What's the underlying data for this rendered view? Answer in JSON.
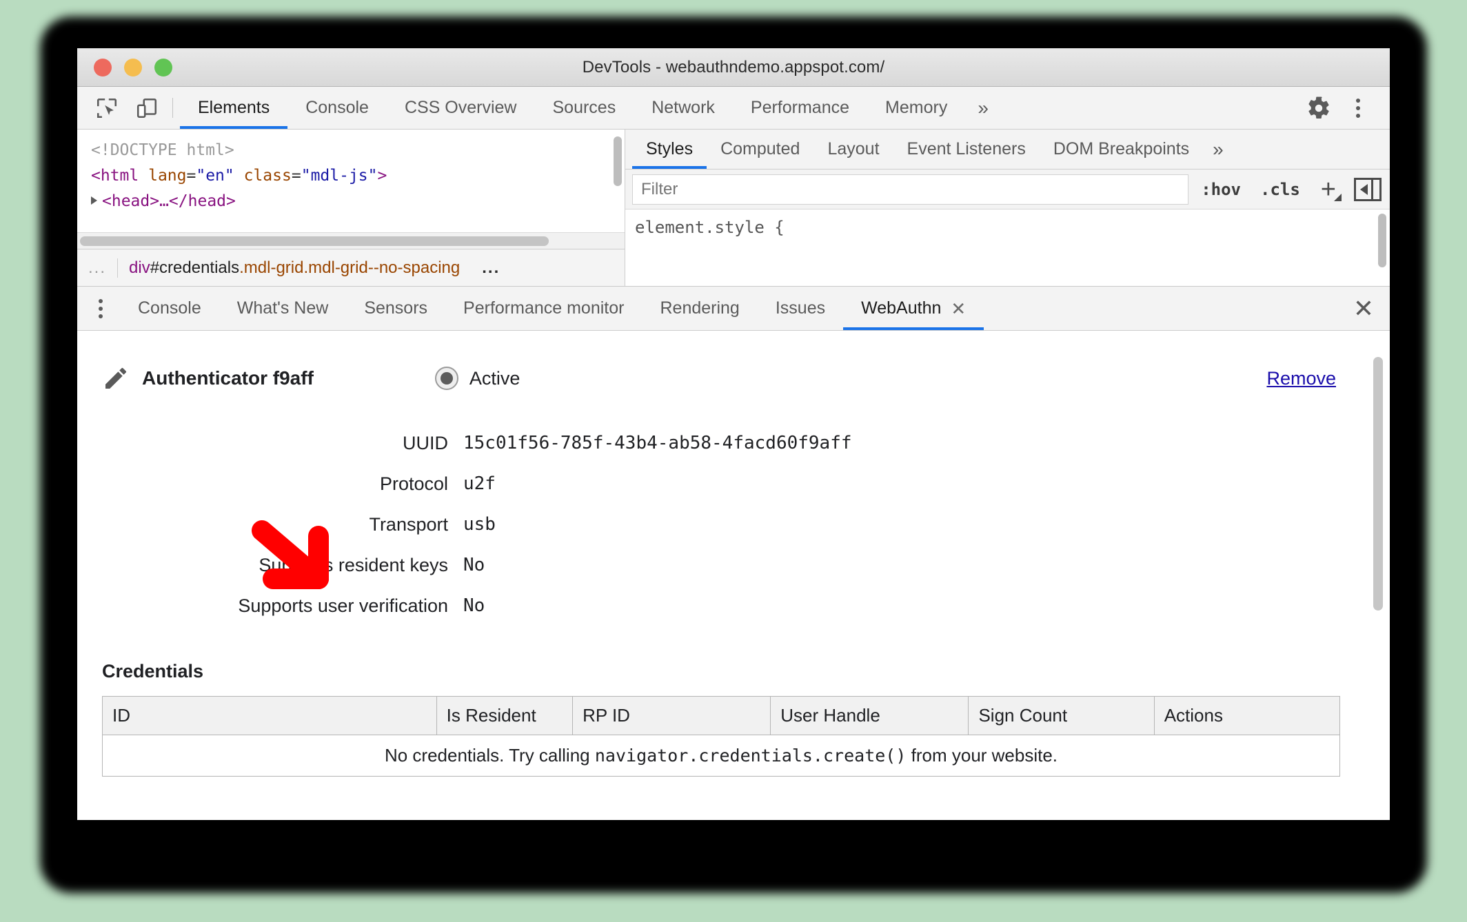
{
  "window": {
    "title": "DevTools - webauthndemo.appspot.com/",
    "traffic_lights": [
      "close-red",
      "minimize-yellow",
      "maximize-green"
    ]
  },
  "main_toolbar": {
    "icons": [
      "inspect-element-icon",
      "device-toolbar-icon"
    ],
    "tabs": [
      {
        "label": "Elements",
        "active": true
      },
      {
        "label": "Console",
        "active": false
      },
      {
        "label": "CSS Overview",
        "active": false
      },
      {
        "label": "Sources",
        "active": false
      },
      {
        "label": "Network",
        "active": false
      },
      {
        "label": "Performance",
        "active": false
      },
      {
        "label": "Memory",
        "active": false
      }
    ],
    "overflow": "»",
    "settings_icon": "gear-icon",
    "more_icon": "three-dot-menu-icon"
  },
  "dom_tree": {
    "lines": [
      {
        "type": "doctype",
        "text": "<!DOCTYPE html>"
      },
      {
        "type": "element",
        "tag_open": "<html",
        "attr1_name": "lang",
        "attr1_value": "\"en\"",
        "attr2_name": "class",
        "attr2_value": "\"mdl-js\"",
        "tag_close": ">"
      },
      {
        "type": "collapsed",
        "text": "<head>…</head>"
      }
    ]
  },
  "breadcrumb": {
    "left_ellipsis": "...",
    "tag": "div",
    "id": "#credentials",
    "classes": ".mdl-grid.mdl-grid--no-spacing",
    "right_ellipsis": "..."
  },
  "styles_pane": {
    "tabs": [
      {
        "label": "Styles",
        "active": true
      },
      {
        "label": "Computed",
        "active": false
      },
      {
        "label": "Layout",
        "active": false
      },
      {
        "label": "Event Listeners",
        "active": false
      },
      {
        "label": "DOM Breakpoints",
        "active": false
      }
    ],
    "overflow": "»",
    "filter_placeholder": "Filter",
    "filter_value": "",
    "hov_button": ":hov",
    "cls_button": ".cls",
    "new_rule_button": "+",
    "sidebar_toggle_icon": "panel-toggle-icon",
    "rule_text": "element.style {"
  },
  "drawer": {
    "menu_icon": "three-dot-menu-icon",
    "tabs": [
      {
        "label": "Console",
        "active": false,
        "closable": false
      },
      {
        "label": "What's New",
        "active": false,
        "closable": false
      },
      {
        "label": "Sensors",
        "active": false,
        "closable": false
      },
      {
        "label": "Performance monitor",
        "active": false,
        "closable": false
      },
      {
        "label": "Rendering",
        "active": false,
        "closable": false
      },
      {
        "label": "Issues",
        "active": false,
        "closable": false
      },
      {
        "label": "WebAuthn",
        "active": true,
        "closable": true,
        "close_glyph": "✕"
      }
    ],
    "close_glyph": "✕"
  },
  "webauthn": {
    "edit_icon": "pencil-icon",
    "authenticator_title": "Authenticator f9aff",
    "active_label": "Active",
    "active_selected": true,
    "remove_label": "Remove",
    "fields": [
      {
        "label": "UUID",
        "value": "15c01f56-785f-43b4-ab58-4facd60f9aff"
      },
      {
        "label": "Protocol",
        "value": "u2f"
      },
      {
        "label": "Transport",
        "value": "usb"
      },
      {
        "label": "Supports resident keys",
        "value": "No"
      },
      {
        "label": "Supports user verification",
        "value": "No"
      }
    ],
    "credentials_heading": "Credentials",
    "table": {
      "columns": [
        "ID",
        "Is Resident",
        "RP ID",
        "User Handle",
        "Sign Count",
        "Actions"
      ],
      "rows": [],
      "empty_message_prefix": "No credentials. Try calling ",
      "empty_message_code": "navigator.credentials.create()",
      "empty_message_suffix": " from your website."
    }
  },
  "annotation": {
    "arrow": "red-arrow-pointing-down-right",
    "color": "#FF0000"
  },
  "colors": {
    "accent_blue": "#1a73e8",
    "link_blue": "#1a0dab",
    "annotation_red": "#FF0000",
    "traffic_red": "#ed6a5e",
    "traffic_yellow": "#f5bd4f",
    "traffic_green": "#61c454"
  }
}
